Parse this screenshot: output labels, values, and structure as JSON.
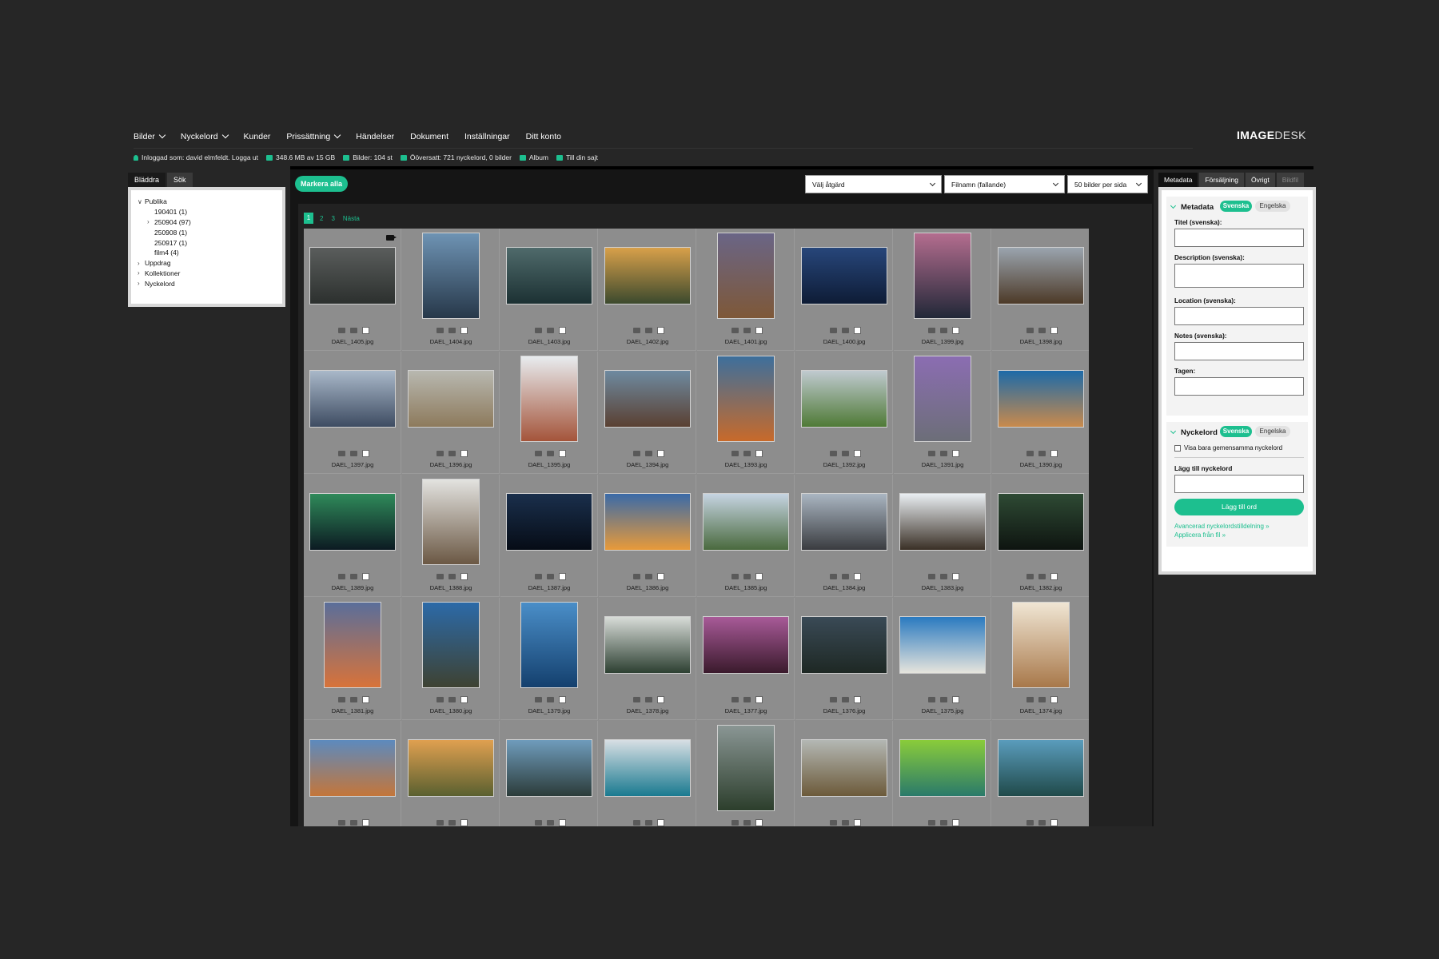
{
  "nav": {
    "items": [
      {
        "label": "Bilder",
        "dropdown": true
      },
      {
        "label": "Nyckelord",
        "dropdown": true
      },
      {
        "label": "Kunder",
        "dropdown": false
      },
      {
        "label": "Prissättning",
        "dropdown": true
      },
      {
        "label": "Händelser",
        "dropdown": false
      },
      {
        "label": "Dokument",
        "dropdown": false
      },
      {
        "label": "Inställningar",
        "dropdown": false
      },
      {
        "label": "Ditt konto",
        "dropdown": false
      }
    ],
    "logo_bold": "IMAGE",
    "logo_light": "DESK"
  },
  "status": {
    "logged_in": "Inloggad som: david elmfeldt. Logga ut",
    "storage": "348.6 MB av 15 GB",
    "images": "Bilder: 104 st",
    "untranslated": "Ööversatt: 721 nyckelord, 0 bilder",
    "album": "Album",
    "site": "Till din sajt"
  },
  "left": {
    "tabs": [
      "Bläddra",
      "Sök"
    ],
    "tree": [
      {
        "label": "Publika",
        "level": 1,
        "toggle": "v"
      },
      {
        "label": "190401 (1)",
        "level": 2,
        "toggle": ""
      },
      {
        "label": "250904 (97)",
        "level": 2,
        "toggle": ">"
      },
      {
        "label": "250908 (1)",
        "level": 2,
        "toggle": ""
      },
      {
        "label": "250917 (1)",
        "level": 2,
        "toggle": ""
      },
      {
        "label": "film4 (4)",
        "level": 2,
        "toggle": ""
      },
      {
        "label": "Uppdrag",
        "level": 1,
        "toggle": ">"
      },
      {
        "label": "Kollektioner",
        "level": 1,
        "toggle": ">"
      },
      {
        "label": "Nyckelord",
        "level": 1,
        "toggle": ">"
      }
    ]
  },
  "toolbar": {
    "mark_all": "Markera alla",
    "action_select": "Välj åtgärd",
    "sort_select": "Filnamn (fallande)",
    "per_page_select": "50 bilder per sida"
  },
  "pager": {
    "pages": [
      "1",
      "2",
      "3"
    ],
    "next": "Nästa",
    "current": "1"
  },
  "images": [
    {
      "name": "DAEL_1405.jpg",
      "o": "L",
      "c1": "#5a5d5c",
      "c2": "#2c302e",
      "video": true
    },
    {
      "name": "DAEL_1404.jpg",
      "o": "P",
      "c1": "#6e93b4",
      "c2": "#27384a"
    },
    {
      "name": "DAEL_1403.jpg",
      "o": "L",
      "c1": "#4f6a6b",
      "c2": "#1c3133"
    },
    {
      "name": "DAEL_1402.jpg",
      "o": "L",
      "c1": "#d8a04a",
      "c2": "#3c4a2e"
    },
    {
      "name": "DAEL_1401.jpg",
      "o": "P",
      "c1": "#6a6586",
      "c2": "#7e5838"
    },
    {
      "name": "DAEL_1400.jpg",
      "o": "L",
      "c1": "#27467a",
      "c2": "#0e1c36"
    },
    {
      "name": "DAEL_1399.jpg",
      "o": "P",
      "c1": "#b46d8f",
      "c2": "#222838"
    },
    {
      "name": "DAEL_1398.jpg",
      "o": "L",
      "c1": "#9aa4ae",
      "c2": "#4d3a28"
    },
    {
      "name": "DAEL_1397.jpg",
      "o": "L",
      "c1": "#a9b8c9",
      "c2": "#3e4c62"
    },
    {
      "name": "DAEL_1396.jpg",
      "o": "L",
      "c1": "#b8b8b0",
      "c2": "#8d7a5c"
    },
    {
      "name": "DAEL_1395.jpg",
      "o": "P",
      "c1": "#e8ecef",
      "c2": "#a4543a"
    },
    {
      "name": "DAEL_1394.jpg",
      "o": "L",
      "c1": "#6e8aa0",
      "c2": "#5a4032"
    },
    {
      "name": "DAEL_1393.jpg",
      "o": "P",
      "c1": "#3d6f9c",
      "c2": "#c86a2a"
    },
    {
      "name": "DAEL_1392.jpg",
      "o": "L",
      "c1": "#c0cad0",
      "c2": "#4f7a36"
    },
    {
      "name": "DAEL_1391.jpg",
      "o": "P",
      "c1": "#8b6db2",
      "c2": "#6c6e78"
    },
    {
      "name": "DAEL_1390.jpg",
      "o": "L",
      "c1": "#1d6aa8",
      "c2": "#c98a4c"
    },
    {
      "name": "DAEL_1389.jpg",
      "o": "L",
      "c1": "#2f8a5a",
      "c2": "#0c1a22"
    },
    {
      "name": "DAEL_1388.jpg",
      "o": "P",
      "c1": "#e3e3e0",
      "c2": "#6b5844"
    },
    {
      "name": "DAEL_1387.jpg",
      "o": "L",
      "c1": "#1a2f4c",
      "c2": "#060c16"
    },
    {
      "name": "DAEL_1386.jpg",
      "o": "L",
      "c1": "#3a6aa8",
      "c2": "#e89a3a"
    },
    {
      "name": "DAEL_1385.jpg",
      "o": "L",
      "c1": "#c6d4e2",
      "c2": "#4a6a3e"
    },
    {
      "name": "DAEL_1384.jpg",
      "o": "L",
      "c1": "#aab6c2",
      "c2": "#3a3c40"
    },
    {
      "name": "DAEL_1383.jpg",
      "o": "L",
      "c1": "#e9eef2",
      "c2": "#3a3026"
    },
    {
      "name": "DAEL_1382.jpg",
      "o": "L",
      "c1": "#2e4a34",
      "c2": "#0e1410"
    },
    {
      "name": "DAEL_1381.jpg",
      "o": "P",
      "c1": "#5a6e9a",
      "c2": "#d8733a"
    },
    {
      "name": "DAEL_1380.jpg",
      "o": "P",
      "c1": "#2c6aa8",
      "c2": "#3e4232"
    },
    {
      "name": "DAEL_1379.jpg",
      "o": "P",
      "c1": "#4a8ec8",
      "c2": "#14406e"
    },
    {
      "name": "DAEL_1378.jpg",
      "o": "L",
      "c1": "#d8dcd8",
      "c2": "#2d4032"
    },
    {
      "name": "DAEL_1377.jpg",
      "o": "L",
      "c1": "#a85a98",
      "c2": "#3a1a2c"
    },
    {
      "name": "DAEL_1376.jpg",
      "o": "L",
      "c1": "#3a4a56",
      "c2": "#1e2824"
    },
    {
      "name": "DAEL_1375.jpg",
      "o": "L",
      "c1": "#2a7ac0",
      "c2": "#e6e4dc"
    },
    {
      "name": "DAEL_1374.jpg",
      "o": "P",
      "c1": "#f0e6d4",
      "c2": "#a8784a"
    },
    {
      "name": "",
      "o": "L",
      "c1": "#5c8abe",
      "c2": "#c4763a"
    },
    {
      "name": "",
      "o": "L",
      "c1": "#e0a050",
      "c2": "#5a6030"
    },
    {
      "name": "",
      "o": "L",
      "c1": "#6f9cbc",
      "c2": "#2c3c3a"
    },
    {
      "name": "",
      "o": "L",
      "c1": "#d8dfe4",
      "c2": "#1a7a90"
    },
    {
      "name": "",
      "o": "P",
      "c1": "#8a9694",
      "c2": "#2c3e2c"
    },
    {
      "name": "",
      "o": "L",
      "c1": "#b4b8b4",
      "c2": "#6c5a3a"
    },
    {
      "name": "",
      "o": "L",
      "c1": "#8acc3a",
      "c2": "#2a7a6a"
    },
    {
      "name": "",
      "o": "L",
      "c1": "#5a9cbc",
      "c2": "#204a4a"
    }
  ],
  "right": {
    "tabs": [
      "Metadata",
      "Försäljning",
      "Övrigt",
      "Bildfil"
    ],
    "metadata": {
      "title": "Metadata",
      "lang_on": "Svenska",
      "lang_off": "Engelska",
      "fields": [
        "Titel (svenska):",
        "Description (svenska):",
        "Location (svenska):",
        "Notes (svenska):",
        "Tagen:"
      ]
    },
    "keywords": {
      "title": "Nyckelord",
      "lang_on": "Svenska",
      "lang_off": "Engelska",
      "checkbox": "Visa bara gemensamma nyckelord",
      "add_label": "Lägg till nyckelord",
      "add_button": "Lägg till ord",
      "link_advanced": "Avancerad nyckelordstilldelning »",
      "link_file": "Applicera från fil »"
    }
  }
}
